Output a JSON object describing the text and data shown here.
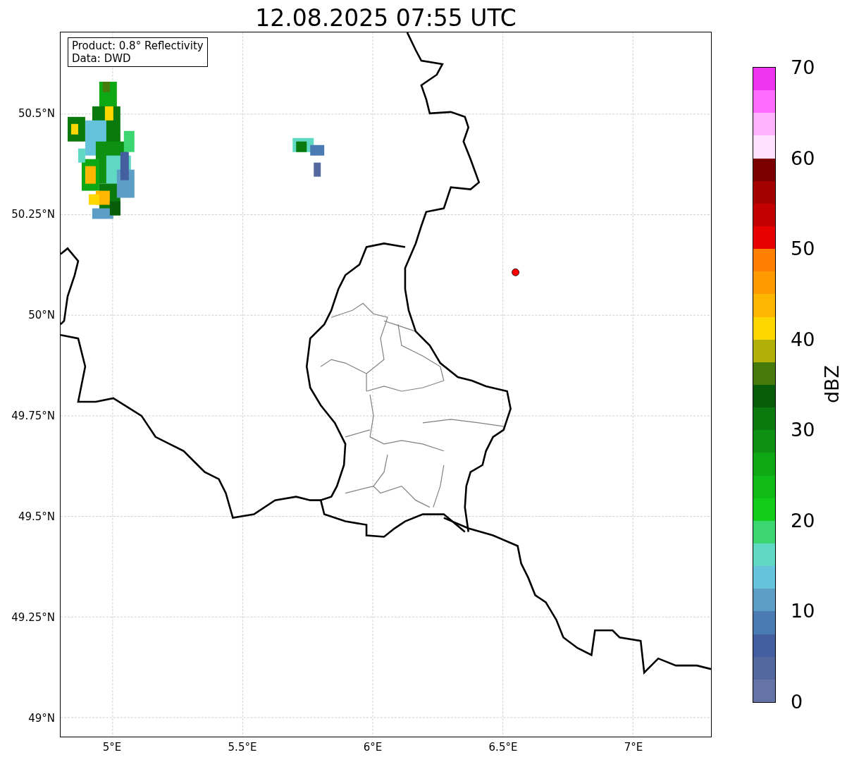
{
  "title": "12.08.2025 07:55 UTC",
  "legend": [
    "Product: 0.8° Reflectivity",
    "Data: DWD"
  ],
  "x_ticks": [
    "5°E",
    "5.5°E",
    "6°E",
    "6.5°E",
    "7°E"
  ],
  "y_ticks": [
    "50.5°N",
    "50.25°N",
    "50°N",
    "49.75°N",
    "49.5°N",
    "49.25°N",
    "49°N"
  ],
  "colorbar": {
    "label": "dBZ",
    "ticks": [
      "70",
      "60",
      "50",
      "40",
      "30",
      "20",
      "10",
      "0"
    ],
    "segments": [
      {
        "color": "#6574a7"
      },
      {
        "color": "#52689f"
      },
      {
        "color": "#435fa0"
      },
      {
        "color": "#4a7bb2"
      },
      {
        "color": "#5c9ec6"
      },
      {
        "color": "#66c3dc"
      },
      {
        "color": "#5fd9c4"
      },
      {
        "color": "#3cd671"
      },
      {
        "color": "#13cc1a"
      },
      {
        "color": "#10bb17"
      },
      {
        "color": "#0fa815"
      },
      {
        "color": "#0e9012"
      },
      {
        "color": "#0a7a0e"
      },
      {
        "color": "#075d0a"
      },
      {
        "color": "#467a0b"
      },
      {
        "color": "#b0b008"
      },
      {
        "color": "#ffd700"
      },
      {
        "color": "#ffb600"
      },
      {
        "color": "#ff9a00"
      },
      {
        "color": "#ff7f00"
      },
      {
        "color": "#e60000"
      },
      {
        "color": "#c20000"
      },
      {
        "color": "#a50000"
      },
      {
        "color": "#7a0000"
      },
      {
        "color": "#ffe0ff"
      },
      {
        "color": "#ffb3ff"
      },
      {
        "color": "#ff6cff"
      },
      {
        "color": "#ee34ee"
      }
    ]
  }
}
